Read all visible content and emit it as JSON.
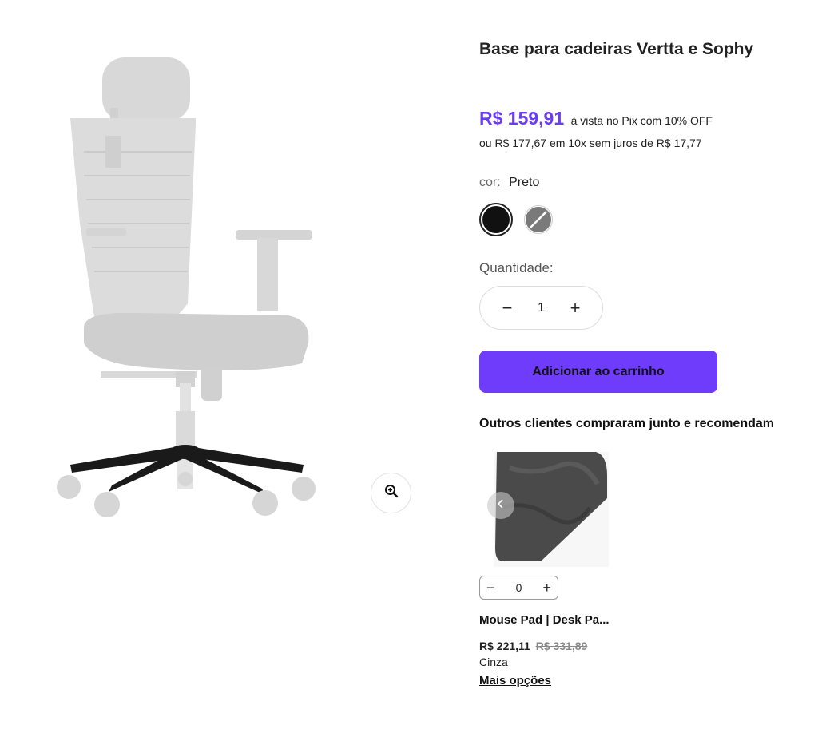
{
  "product": {
    "title": "Base para cadeiras Vertta e Sophy",
    "price": "R$ 159,91",
    "pix_text": "à vista no Pix com 10% OFF",
    "installments": "ou R$ 177,67 em 10x sem juros de R$ 17,77"
  },
  "color": {
    "label": "cor:",
    "selected": "Preto",
    "swatches": [
      {
        "name": "Preto",
        "hex": "#111111"
      },
      {
        "name": "Cinza",
        "hex": "#777777"
      }
    ]
  },
  "quantity": {
    "label": "Quantidade:",
    "minus": "−",
    "value": "1",
    "plus": "+"
  },
  "cart": {
    "add_label": "Adicionar ao carrinho",
    "accent": "#6e3cfa"
  },
  "recommendations": {
    "title": "Outros clientes compraram junto e recomendam",
    "items": [
      {
        "name": "Mouse Pad | Desk Pa...",
        "price": "R$ 221,11",
        "old_price": "R$ 331,89",
        "color": "Cinza",
        "more": "Mais opções",
        "qty_minus": "−",
        "qty_value": "0",
        "qty_plus": "+"
      }
    ]
  },
  "icons": {
    "zoom": "zoom-in-icon",
    "carousel_prev": "chevron-left-icon"
  }
}
